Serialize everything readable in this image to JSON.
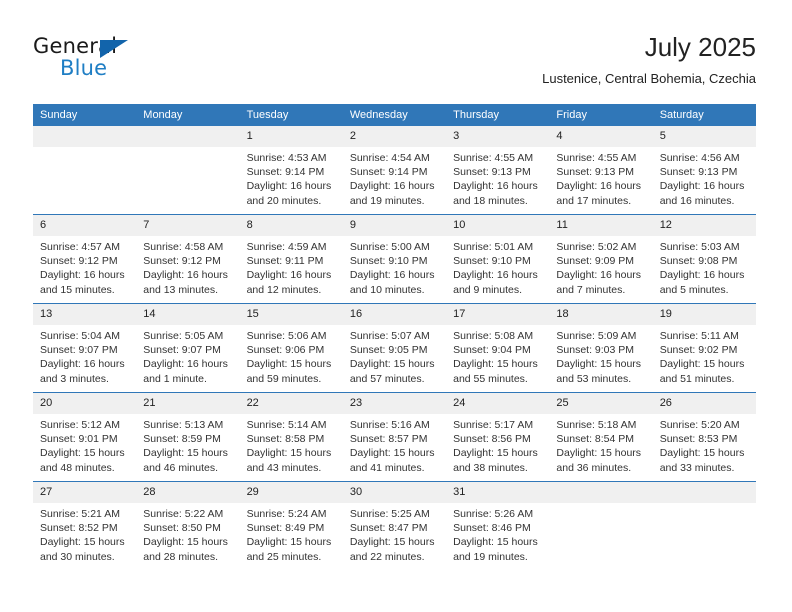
{
  "brand": {
    "name_top": "General",
    "name_bottom": "Blue",
    "accent_color": "#1f7ec4",
    "triangle_color": "#1264ab"
  },
  "header": {
    "month_title": "July 2025",
    "location": "Lustenice, Central Bohemia, Czechia",
    "header_bg_color": "#3077b8",
    "daynum_bg_color": "#f0f0f0"
  },
  "weekday_headers": [
    "Sunday",
    "Monday",
    "Tuesday",
    "Wednesday",
    "Thursday",
    "Friday",
    "Saturday"
  ],
  "labels": {
    "sunrise_prefix": "Sunrise:",
    "sunset_prefix": "Sunset:",
    "daylight_prefix": "Daylight:"
  },
  "weeks": [
    [
      {
        "day": "",
        "empty": true
      },
      {
        "day": "",
        "empty": true
      },
      {
        "day": "1",
        "sunrise": "Sunrise: 4:53 AM",
        "sunset": "Sunset: 9:14 PM",
        "daylight_1": "Daylight: 16 hours",
        "daylight_2": "and 20 minutes."
      },
      {
        "day": "2",
        "sunrise": "Sunrise: 4:54 AM",
        "sunset": "Sunset: 9:14 PM",
        "daylight_1": "Daylight: 16 hours",
        "daylight_2": "and 19 minutes."
      },
      {
        "day": "3",
        "sunrise": "Sunrise: 4:55 AM",
        "sunset": "Sunset: 9:13 PM",
        "daylight_1": "Daylight: 16 hours",
        "daylight_2": "and 18 minutes."
      },
      {
        "day": "4",
        "sunrise": "Sunrise: 4:55 AM",
        "sunset": "Sunset: 9:13 PM",
        "daylight_1": "Daylight: 16 hours",
        "daylight_2": "and 17 minutes."
      },
      {
        "day": "5",
        "sunrise": "Sunrise: 4:56 AM",
        "sunset": "Sunset: 9:13 PM",
        "daylight_1": "Daylight: 16 hours",
        "daylight_2": "and 16 minutes."
      }
    ],
    [
      {
        "day": "6",
        "sunrise": "Sunrise: 4:57 AM",
        "sunset": "Sunset: 9:12 PM",
        "daylight_1": "Daylight: 16 hours",
        "daylight_2": "and 15 minutes."
      },
      {
        "day": "7",
        "sunrise": "Sunrise: 4:58 AM",
        "sunset": "Sunset: 9:12 PM",
        "daylight_1": "Daylight: 16 hours",
        "daylight_2": "and 13 minutes."
      },
      {
        "day": "8",
        "sunrise": "Sunrise: 4:59 AM",
        "sunset": "Sunset: 9:11 PM",
        "daylight_1": "Daylight: 16 hours",
        "daylight_2": "and 12 minutes."
      },
      {
        "day": "9",
        "sunrise": "Sunrise: 5:00 AM",
        "sunset": "Sunset: 9:10 PM",
        "daylight_1": "Daylight: 16 hours",
        "daylight_2": "and 10 minutes."
      },
      {
        "day": "10",
        "sunrise": "Sunrise: 5:01 AM",
        "sunset": "Sunset: 9:10 PM",
        "daylight_1": "Daylight: 16 hours",
        "daylight_2": "and 9 minutes."
      },
      {
        "day": "11",
        "sunrise": "Sunrise: 5:02 AM",
        "sunset": "Sunset: 9:09 PM",
        "daylight_1": "Daylight: 16 hours",
        "daylight_2": "and 7 minutes."
      },
      {
        "day": "12",
        "sunrise": "Sunrise: 5:03 AM",
        "sunset": "Sunset: 9:08 PM",
        "daylight_1": "Daylight: 16 hours",
        "daylight_2": "and 5 minutes."
      }
    ],
    [
      {
        "day": "13",
        "sunrise": "Sunrise: 5:04 AM",
        "sunset": "Sunset: 9:07 PM",
        "daylight_1": "Daylight: 16 hours",
        "daylight_2": "and 3 minutes."
      },
      {
        "day": "14",
        "sunrise": "Sunrise: 5:05 AM",
        "sunset": "Sunset: 9:07 PM",
        "daylight_1": "Daylight: 16 hours",
        "daylight_2": "and 1 minute."
      },
      {
        "day": "15",
        "sunrise": "Sunrise: 5:06 AM",
        "sunset": "Sunset: 9:06 PM",
        "daylight_1": "Daylight: 15 hours",
        "daylight_2": "and 59 minutes."
      },
      {
        "day": "16",
        "sunrise": "Sunrise: 5:07 AM",
        "sunset": "Sunset: 9:05 PM",
        "daylight_1": "Daylight: 15 hours",
        "daylight_2": "and 57 minutes."
      },
      {
        "day": "17",
        "sunrise": "Sunrise: 5:08 AM",
        "sunset": "Sunset: 9:04 PM",
        "daylight_1": "Daylight: 15 hours",
        "daylight_2": "and 55 minutes."
      },
      {
        "day": "18",
        "sunrise": "Sunrise: 5:09 AM",
        "sunset": "Sunset: 9:03 PM",
        "daylight_1": "Daylight: 15 hours",
        "daylight_2": "and 53 minutes."
      },
      {
        "day": "19",
        "sunrise": "Sunrise: 5:11 AM",
        "sunset": "Sunset: 9:02 PM",
        "daylight_1": "Daylight: 15 hours",
        "daylight_2": "and 51 minutes."
      }
    ],
    [
      {
        "day": "20",
        "sunrise": "Sunrise: 5:12 AM",
        "sunset": "Sunset: 9:01 PM",
        "daylight_1": "Daylight: 15 hours",
        "daylight_2": "and 48 minutes."
      },
      {
        "day": "21",
        "sunrise": "Sunrise: 5:13 AM",
        "sunset": "Sunset: 8:59 PM",
        "daylight_1": "Daylight: 15 hours",
        "daylight_2": "and 46 minutes."
      },
      {
        "day": "22",
        "sunrise": "Sunrise: 5:14 AM",
        "sunset": "Sunset: 8:58 PM",
        "daylight_1": "Daylight: 15 hours",
        "daylight_2": "and 43 minutes."
      },
      {
        "day": "23",
        "sunrise": "Sunrise: 5:16 AM",
        "sunset": "Sunset: 8:57 PM",
        "daylight_1": "Daylight: 15 hours",
        "daylight_2": "and 41 minutes."
      },
      {
        "day": "24",
        "sunrise": "Sunrise: 5:17 AM",
        "sunset": "Sunset: 8:56 PM",
        "daylight_1": "Daylight: 15 hours",
        "daylight_2": "and 38 minutes."
      },
      {
        "day": "25",
        "sunrise": "Sunrise: 5:18 AM",
        "sunset": "Sunset: 8:54 PM",
        "daylight_1": "Daylight: 15 hours",
        "daylight_2": "and 36 minutes."
      },
      {
        "day": "26",
        "sunrise": "Sunrise: 5:20 AM",
        "sunset": "Sunset: 8:53 PM",
        "daylight_1": "Daylight: 15 hours",
        "daylight_2": "and 33 minutes."
      }
    ],
    [
      {
        "day": "27",
        "sunrise": "Sunrise: 5:21 AM",
        "sunset": "Sunset: 8:52 PM",
        "daylight_1": "Daylight: 15 hours",
        "daylight_2": "and 30 minutes."
      },
      {
        "day": "28",
        "sunrise": "Sunrise: 5:22 AM",
        "sunset": "Sunset: 8:50 PM",
        "daylight_1": "Daylight: 15 hours",
        "daylight_2": "and 28 minutes."
      },
      {
        "day": "29",
        "sunrise": "Sunrise: 5:24 AM",
        "sunset": "Sunset: 8:49 PM",
        "daylight_1": "Daylight: 15 hours",
        "daylight_2": "and 25 minutes."
      },
      {
        "day": "30",
        "sunrise": "Sunrise: 5:25 AM",
        "sunset": "Sunset: 8:47 PM",
        "daylight_1": "Daylight: 15 hours",
        "daylight_2": "and 22 minutes."
      },
      {
        "day": "31",
        "sunrise": "Sunrise: 5:26 AM",
        "sunset": "Sunset: 8:46 PM",
        "daylight_1": "Daylight: 15 hours",
        "daylight_2": "and 19 minutes."
      },
      {
        "day": "",
        "empty": true
      },
      {
        "day": "",
        "empty": true
      }
    ]
  ]
}
